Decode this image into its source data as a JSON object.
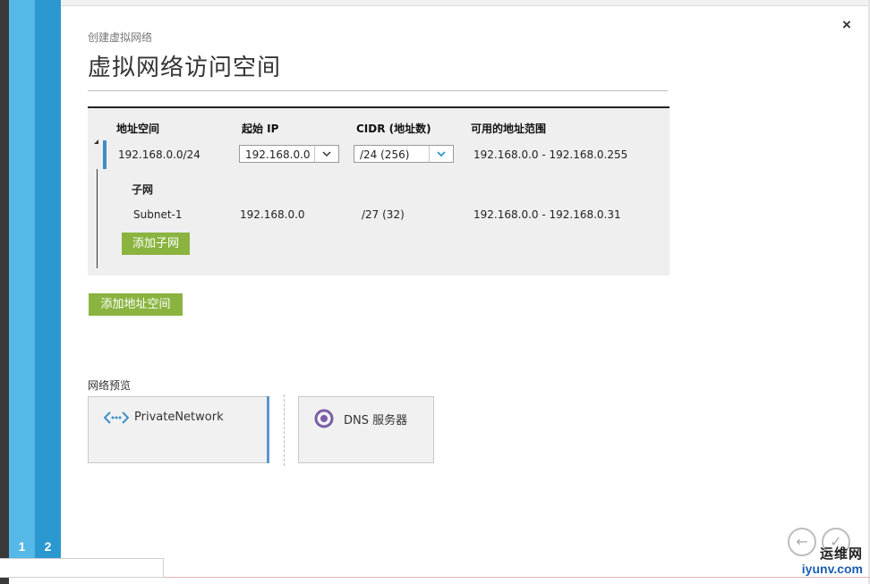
{
  "wizard": {
    "steps": [
      "1",
      "2"
    ],
    "breadcrumb": "创建虚拟网络",
    "title": "虚拟网络访问空间",
    "close_icon": "×"
  },
  "address_table": {
    "headers": [
      "地址空间",
      "起始 IP",
      "CIDR (地址数)",
      "可用的地址范围"
    ],
    "address_space": {
      "name": "192.168.0.0/24",
      "start_ip": "192.168.0.0",
      "cidr": "/24 (256)",
      "range": "192.168.0.0 - 192.168.0.255"
    },
    "subnet_header": "子网",
    "subnets": [
      {
        "name": "Subnet-1",
        "start_ip": "192.168.0.0",
        "cidr": "/27 (32)",
        "range": "192.168.0.0 - 192.168.0.31"
      }
    ],
    "add_subnet_label": "添加子网"
  },
  "add_address_space_label": "添加地址空间",
  "network_preview": {
    "label": "网络预览",
    "cards": [
      {
        "name": "PrivateNetwork",
        "icon": "network-icon"
      },
      {
        "name": "DNS 服务器",
        "icon": "dns-server-icon"
      }
    ]
  },
  "watermark": {
    "top": "运维网",
    "bottom": "iyunv.com"
  },
  "colors": {
    "green": "#8ab43f",
    "accent_blue": "#2b98cf",
    "light_blue": "#55b8e6",
    "dns_purple": "#7b5ea7"
  }
}
